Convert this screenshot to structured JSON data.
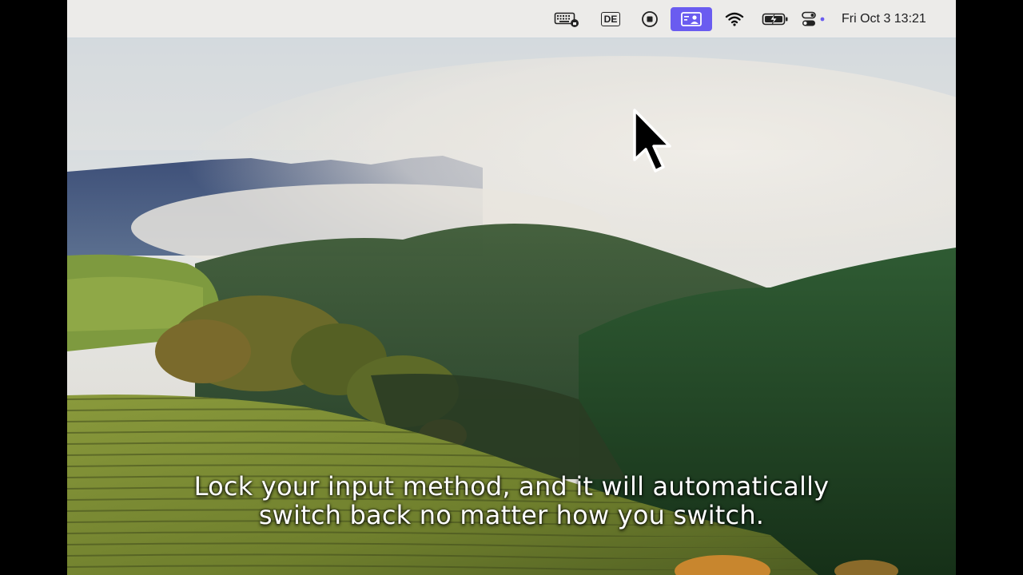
{
  "menubar": {
    "icons": [
      {
        "name": "keyboard-lock-icon"
      },
      {
        "name": "input-source-icon",
        "label": "DE"
      },
      {
        "name": "record-stop-icon"
      },
      {
        "name": "screen-share-icon",
        "active_color": "#6a5cf0"
      },
      {
        "name": "wifi-icon"
      },
      {
        "name": "battery-charging-icon"
      },
      {
        "name": "control-center-icon",
        "dot_color": "#6a5cf0"
      }
    ],
    "clock": "Fri Oct 3  13:21"
  },
  "subtitle": {
    "line1": "Lock your input method, and it will automatically",
    "line2": "switch back no matter how you switch."
  },
  "colors": {
    "menubar_bg": "#ecebe9",
    "accent": "#6a5cf0"
  }
}
